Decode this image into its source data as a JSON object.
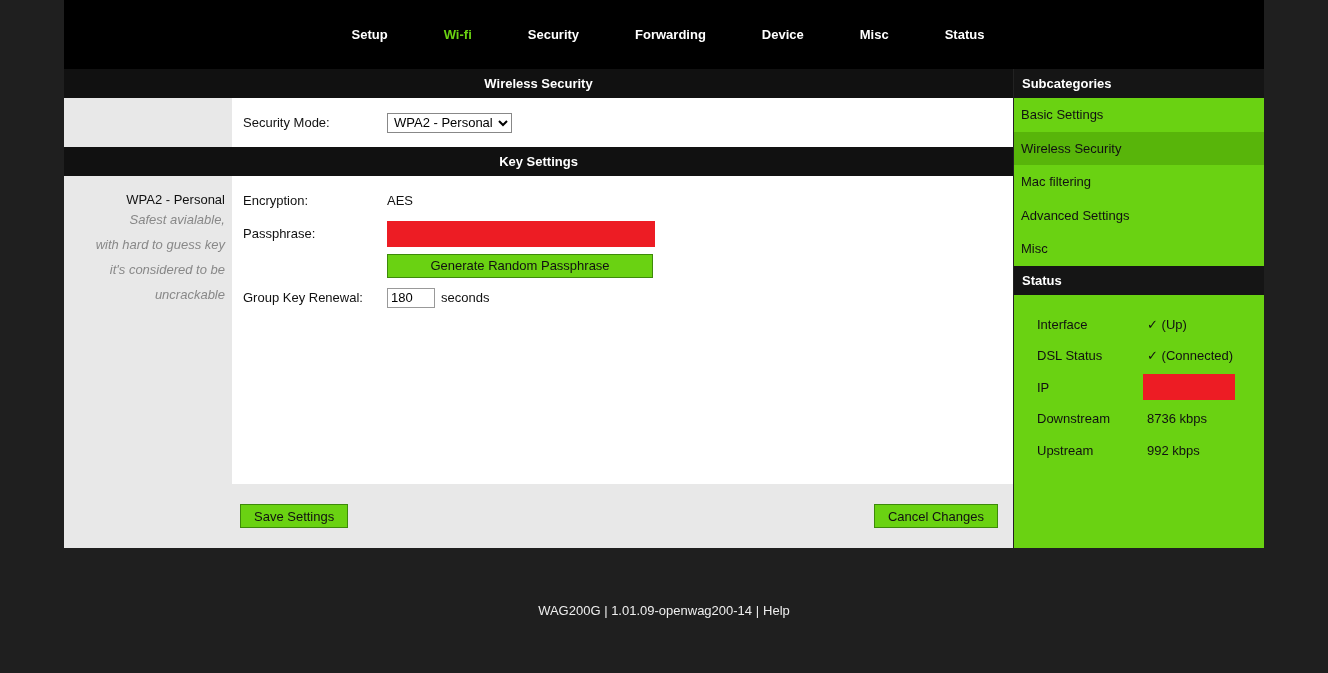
{
  "nav": [
    {
      "label": "Setup",
      "selected": false
    },
    {
      "label": "Wi-fi",
      "selected": true
    },
    {
      "label": "Security",
      "selected": false
    },
    {
      "label": "Forwarding",
      "selected": false
    },
    {
      "label": "Device",
      "selected": false
    },
    {
      "label": "Misc",
      "selected": false
    },
    {
      "label": "Status",
      "selected": false
    }
  ],
  "security_section": {
    "title": "Wireless Security",
    "security_mode": {
      "label": "Security Mode:",
      "value": "WPA2 - Personal"
    }
  },
  "key_section": {
    "title": "Key Settings",
    "description": {
      "title": "WPA2 - Personal",
      "lines": [
        "Safest avialable,",
        "with hard to guess key",
        "it's considered to be",
        "uncrackable"
      ]
    },
    "encryption": {
      "label": "Encryption:",
      "value": "AES"
    },
    "passphrase": {
      "label": "Passphrase:",
      "button": "Generate Random Passphrase"
    },
    "group_key_renewal": {
      "label": "Group Key Renewal:",
      "value": "180",
      "unit": "seconds"
    }
  },
  "actions": {
    "save": "Save Settings",
    "cancel": "Cancel Changes"
  },
  "sidebar": {
    "title": "Subcategories",
    "items": [
      {
        "label": "Basic Settings",
        "selected": false
      },
      {
        "label": "Wireless Security",
        "selected": true
      },
      {
        "label": "Mac filtering",
        "selected": false
      },
      {
        "label": "Advanced Settings",
        "selected": false
      },
      {
        "label": "Misc",
        "selected": false
      }
    ]
  },
  "status": {
    "title": "Status",
    "rows": [
      {
        "label": "Interface",
        "value": "✓ (Up)",
        "kind": "text"
      },
      {
        "label": "DSL Status",
        "value": "✓ (Connected)",
        "kind": "text"
      },
      {
        "label": "IP",
        "kind": "redacted"
      },
      {
        "label": "Downstream",
        "value": "8736 kbps",
        "kind": "text"
      },
      {
        "label": "Upstream",
        "value": "992 kbps",
        "kind": "text"
      }
    ]
  },
  "footer": {
    "text": "WAG200G | 1.01.09-openwag200-14 |",
    "link": "Help"
  }
}
